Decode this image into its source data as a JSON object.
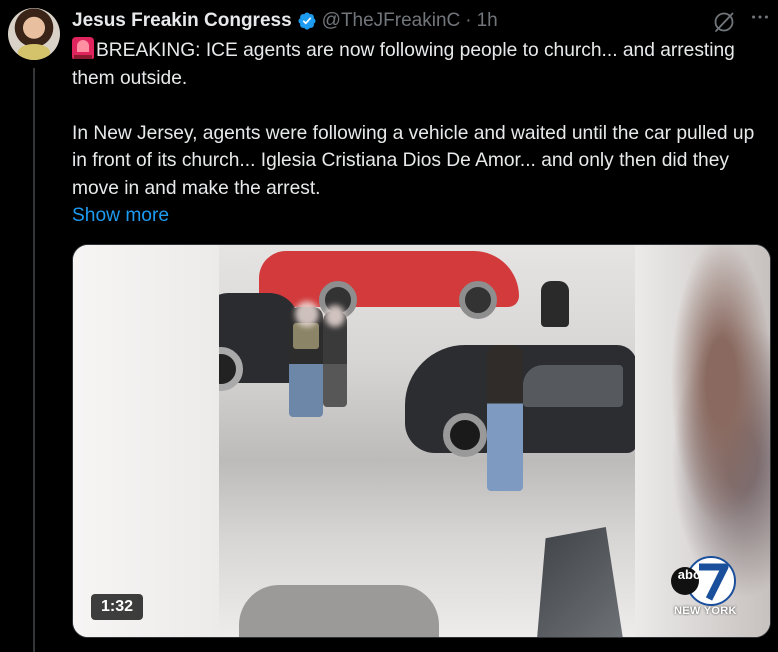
{
  "post": {
    "author_name": "Jesus Freakin Congress",
    "handle": "@TheJFreakinC",
    "separator": "·",
    "time": "1h",
    "text_line1": "BREAKING: ICE agents are now following people to church... and arresting them outside.",
    "text_line2": "In New Jersey, agents were following a vehicle and waited until the car pulled up in front of its church... Iglesia Cristiana Dios De Amor... and only then did they move in and make the arrest.",
    "show_more": "Show more"
  },
  "media": {
    "duration": "1:32",
    "station_logo_text": "abc",
    "station_channel": "7",
    "station_city": "NEW YORK"
  },
  "icons": {
    "verified": "verified-badge-icon",
    "grok": "grok-icon",
    "more": "more-icon",
    "siren": "siren-emoji-icon"
  },
  "colors": {
    "background": "#000000",
    "text": "#e7e9ea",
    "muted": "#71767b",
    "link": "#1d9bf0",
    "verified": "#1d9bf0"
  }
}
